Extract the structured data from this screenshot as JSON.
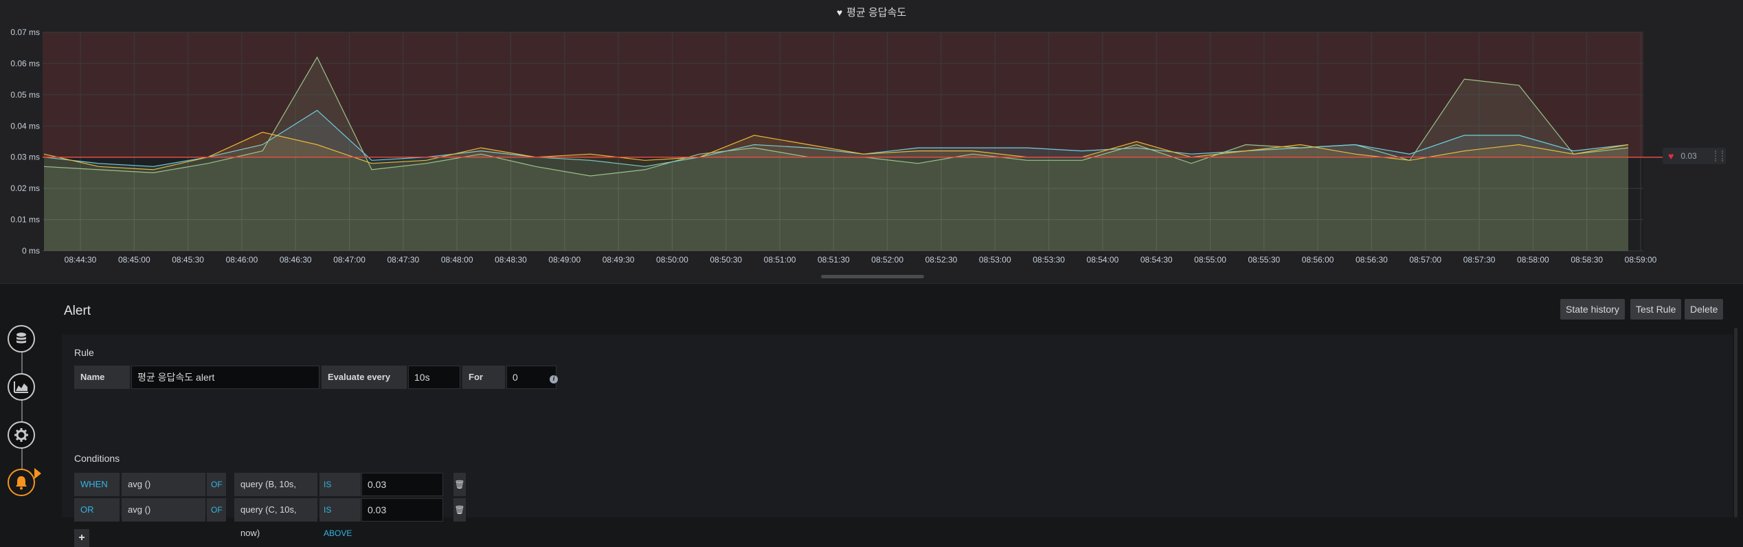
{
  "panel": {
    "title": "평균 응답속도",
    "threshold_value": "0.03"
  },
  "sidebar": {
    "items": [
      {
        "icon": "database-icon"
      },
      {
        "icon": "chart-icon"
      },
      {
        "icon": "gear-icon"
      },
      {
        "icon": "bell-icon",
        "active": true
      }
    ]
  },
  "alert": {
    "title": "Alert",
    "buttons": {
      "state_history": "State history",
      "test_rule": "Test Rule",
      "delete": "Delete"
    },
    "rule": {
      "section": "Rule",
      "name_label": "Name",
      "name_value": "평균 응답속도 alert",
      "evaluate_label": "Evaluate every",
      "evaluate_value": "10s",
      "for_label": "For",
      "for_value": "0"
    },
    "conditions": {
      "section": "Conditions",
      "rows": [
        {
          "op": "WHEN",
          "func": "avg ()",
          "of": "OF",
          "query": "query (B, 10s, now)",
          "cmp": "IS ABOVE",
          "value": "0.03"
        },
        {
          "op": "OR",
          "func": "avg ()",
          "of": "OF",
          "query": "query (C, 10s, now)",
          "cmp": "IS ABOVE",
          "value": "0.03"
        }
      ],
      "add_label": "+"
    }
  },
  "colors": {
    "series_green": "#9ac48a",
    "series_blue": "#6ed0e0",
    "series_orange": "#eab839",
    "threshold_line": "#e24d42",
    "accent": "#33b5e5",
    "active_sidebar": "#f7941e"
  },
  "chart_data": {
    "type": "line",
    "x": [
      "08:44:30",
      "08:45:00",
      "08:45:30",
      "08:46:00",
      "08:46:30",
      "08:47:00",
      "08:47:30",
      "08:48:00",
      "08:48:30",
      "08:49:00",
      "08:49:30",
      "08:50:00",
      "08:50:30",
      "08:51:00",
      "08:51:30",
      "08:52:00",
      "08:52:30",
      "08:53:00",
      "08:53:30",
      "08:54:00",
      "08:54:30",
      "08:55:00",
      "08:55:30",
      "08:56:00",
      "08:56:30",
      "08:57:00",
      "08:57:30",
      "08:58:00",
      "08:58:30",
      "08:59:00"
    ],
    "y_ticks": [
      "0 ms",
      "0.01 ms",
      "0.02 ms",
      "0.03 ms",
      "0.04 ms",
      "0.05 ms",
      "0.06 ms",
      "0.07 ms"
    ],
    "ylim": [
      0,
      0.07
    ],
    "grid": true,
    "threshold": 0.03,
    "series": [
      {
        "color": "#9ac48a",
        "values": [
          0.027,
          0.026,
          0.025,
          0.028,
          0.032,
          0.062,
          0.026,
          0.028,
          0.031,
          0.027,
          0.024,
          0.026,
          0.031,
          0.033,
          0.03,
          0.03,
          0.028,
          0.031,
          0.029,
          0.029,
          0.034,
          0.028,
          0.034,
          0.033,
          0.034,
          0.029,
          0.055,
          0.053,
          0.031,
          0.033
        ]
      },
      {
        "color": "#6ed0e0",
        "values": [
          0.03,
          0.028,
          0.027,
          0.03,
          0.034,
          0.045,
          0.029,
          0.03,
          0.032,
          0.03,
          0.029,
          0.027,
          0.03,
          0.034,
          0.033,
          0.031,
          0.033,
          0.033,
          0.033,
          0.032,
          0.033,
          0.031,
          0.032,
          0.033,
          0.034,
          0.031,
          0.037,
          0.037,
          0.032,
          0.034
        ]
      },
      {
        "color": "#eab839",
        "values": [
          0.031,
          0.027,
          0.026,
          0.03,
          0.038,
          0.034,
          0.028,
          0.029,
          0.033,
          0.03,
          0.031,
          0.029,
          0.03,
          0.037,
          0.034,
          0.031,
          0.032,
          0.032,
          0.03,
          0.03,
          0.035,
          0.03,
          0.032,
          0.034,
          0.031,
          0.029,
          0.032,
          0.034,
          0.031,
          0.034
        ]
      }
    ]
  }
}
